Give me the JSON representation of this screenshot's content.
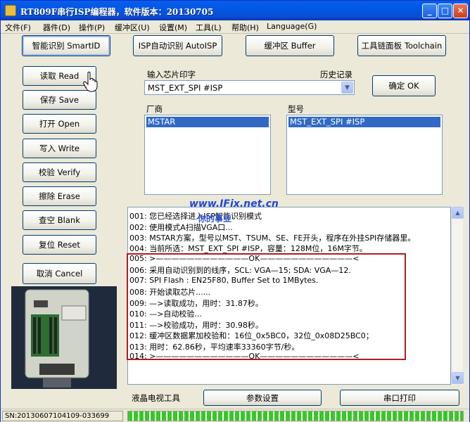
{
  "window": {
    "title": "RT809F串行ISP编程器，软件版本：20130705",
    "min": "_",
    "max": "□",
    "close": "✕"
  },
  "menu": [
    "文件(F)",
    "器件(D)",
    "操作(P)",
    "缓冲区(U)",
    "设置(M)",
    "工具(L)",
    "帮助(H)",
    "Language(G)"
  ],
  "top_buttons": {
    "smartid": "智能识别 SmartID",
    "auto_isp": "ISP自动识别 AutoISP",
    "buffer": "缓冲区 Buffer",
    "toolchain": "工具链面板 Toolchain"
  },
  "left_buttons": [
    "读取 Read",
    "保存 Save",
    "打开 Open",
    "写入 Write",
    "校验 Verify",
    "擦除 Erase",
    "查空 Blank",
    "复位 Reset",
    "取消 Cancel"
  ],
  "chip": {
    "input_label": "输入芯片印字",
    "history_label": "历史记录",
    "value": "MST_EXT_SPI #ISP",
    "ok_button": "确定 OK",
    "vendor_label": "厂商",
    "vendor_selected": "MSTAR",
    "model_label": "型号",
    "model_selected": "MST_EXT_SPI #ISP"
  },
  "log": [
    "001: 您已经选择进入ISP智能识别模式",
    "002: 使用模式A扫描VGA口...",
    "003: MSTAR方案，型号以MST、TSUM、SE、FE开头，程序在外挂SPI存储器里。",
    "004: 当前所选：MST_EXT_SPI #ISP，容量：128M位，16M字节。",
    "005: >————————————OK————————————<",
    "006: 采用自动识别到的线序，SCL: VGA—15; SDA: VGA—12.",
    "007: SPI Flash : EN25F80, Buffer Set to 1MBytes.",
    "008: 开始读取芯片......",
    "009: —>读取成功，用时：31.87秒。",
    "010: —>自动校验...",
    "011: —>校验成功，用时：30.98秒。",
    "012: 缓冲区数据累加校验和：16位_0x5BC0，32位_0x08D25BC0；",
    "013: 用时：62.86秒，平均速率33360字节/秒。",
    "014: >————————————OK————————————<"
  ],
  "watermark": {
    "line1": "www.IFix.net.cn",
    "line2": "你的事业"
  },
  "bottom": {
    "label": "液晶电视工具",
    "params_button": "参数设置",
    "serial_button": "串口打印"
  },
  "status": {
    "sn": "SN:20130607104109-033699",
    "progress_fraction": 1.0
  },
  "colors": {
    "title_blue": "#0058e6",
    "selection": "#316ac5",
    "highlight_box": "#b01c25",
    "progress_green": "#37c828"
  },
  "icons": {
    "app": "chip-icon",
    "cursor": "hand-cursor-icon",
    "dropdown": "chevron-down-icon"
  }
}
